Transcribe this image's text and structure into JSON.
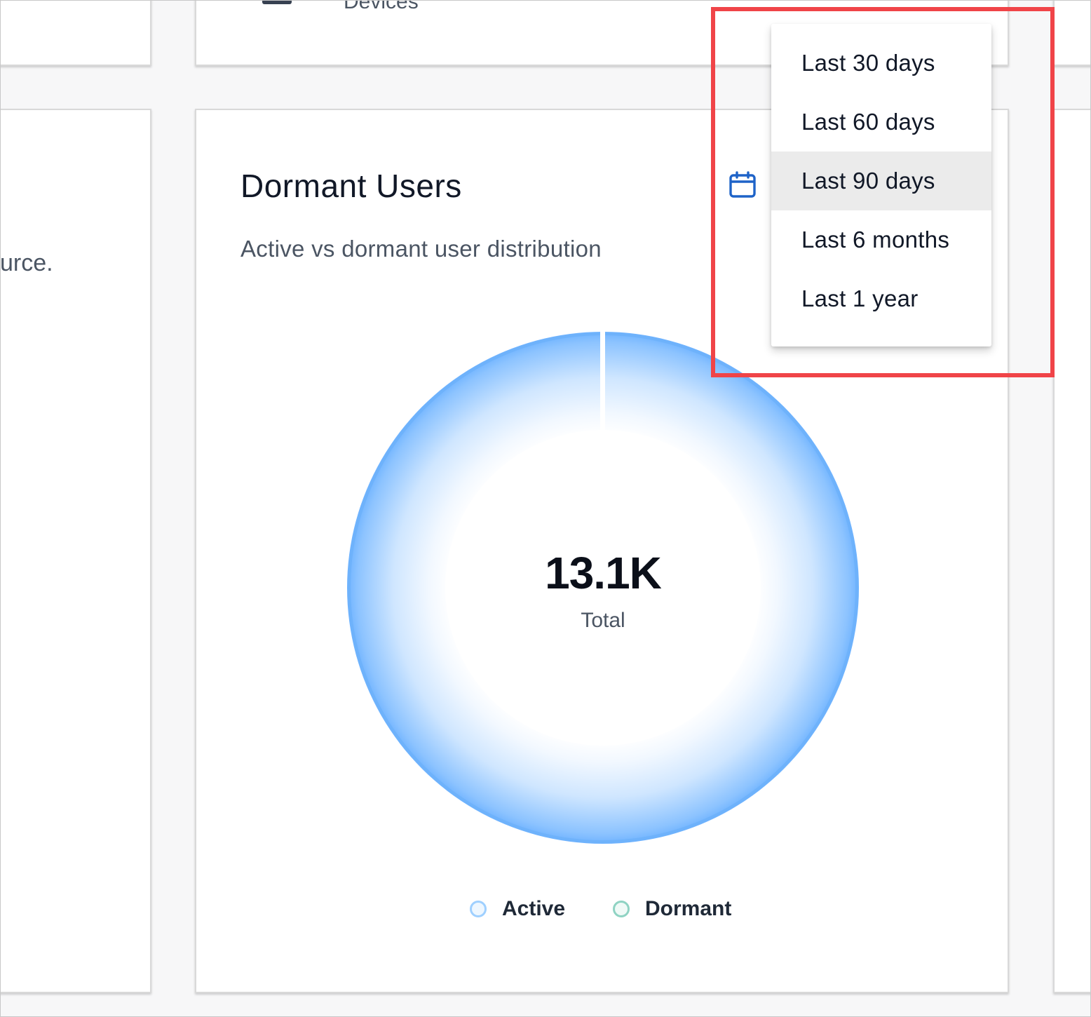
{
  "top_card": {
    "devices_label": "Devices"
  },
  "left_card": {
    "snippet": "urce."
  },
  "dormant_card": {
    "title": "Dormant Users",
    "subtitle": "Active vs dormant user distribution",
    "calendar_icon": "calendar-icon",
    "center_value": "13.1K",
    "center_label": "Total",
    "legend": [
      {
        "label": "Active",
        "color": "#9fd0ff"
      },
      {
        "label": "Dormant",
        "color": "#8fd3c3"
      }
    ]
  },
  "date_range_menu": {
    "options": [
      "Last 30 days",
      "Last 60 days",
      "Last 90 days",
      "Last 6 months",
      "Last 1 year"
    ],
    "selected": "Last 90 days"
  },
  "chart_data": {
    "type": "pie",
    "title": "Dormant Users",
    "subtitle": "Active vs dormant user distribution",
    "categories": [
      "Active",
      "Dormant"
    ],
    "values": [
      13100,
      0
    ],
    "total_label": "13.1K",
    "legend_position": "bottom"
  },
  "colors": {
    "accent": "#1e63c8",
    "highlight": "#f04448",
    "ring_outer": "#6fb3ff",
    "ring_inner": "#ffffff"
  }
}
